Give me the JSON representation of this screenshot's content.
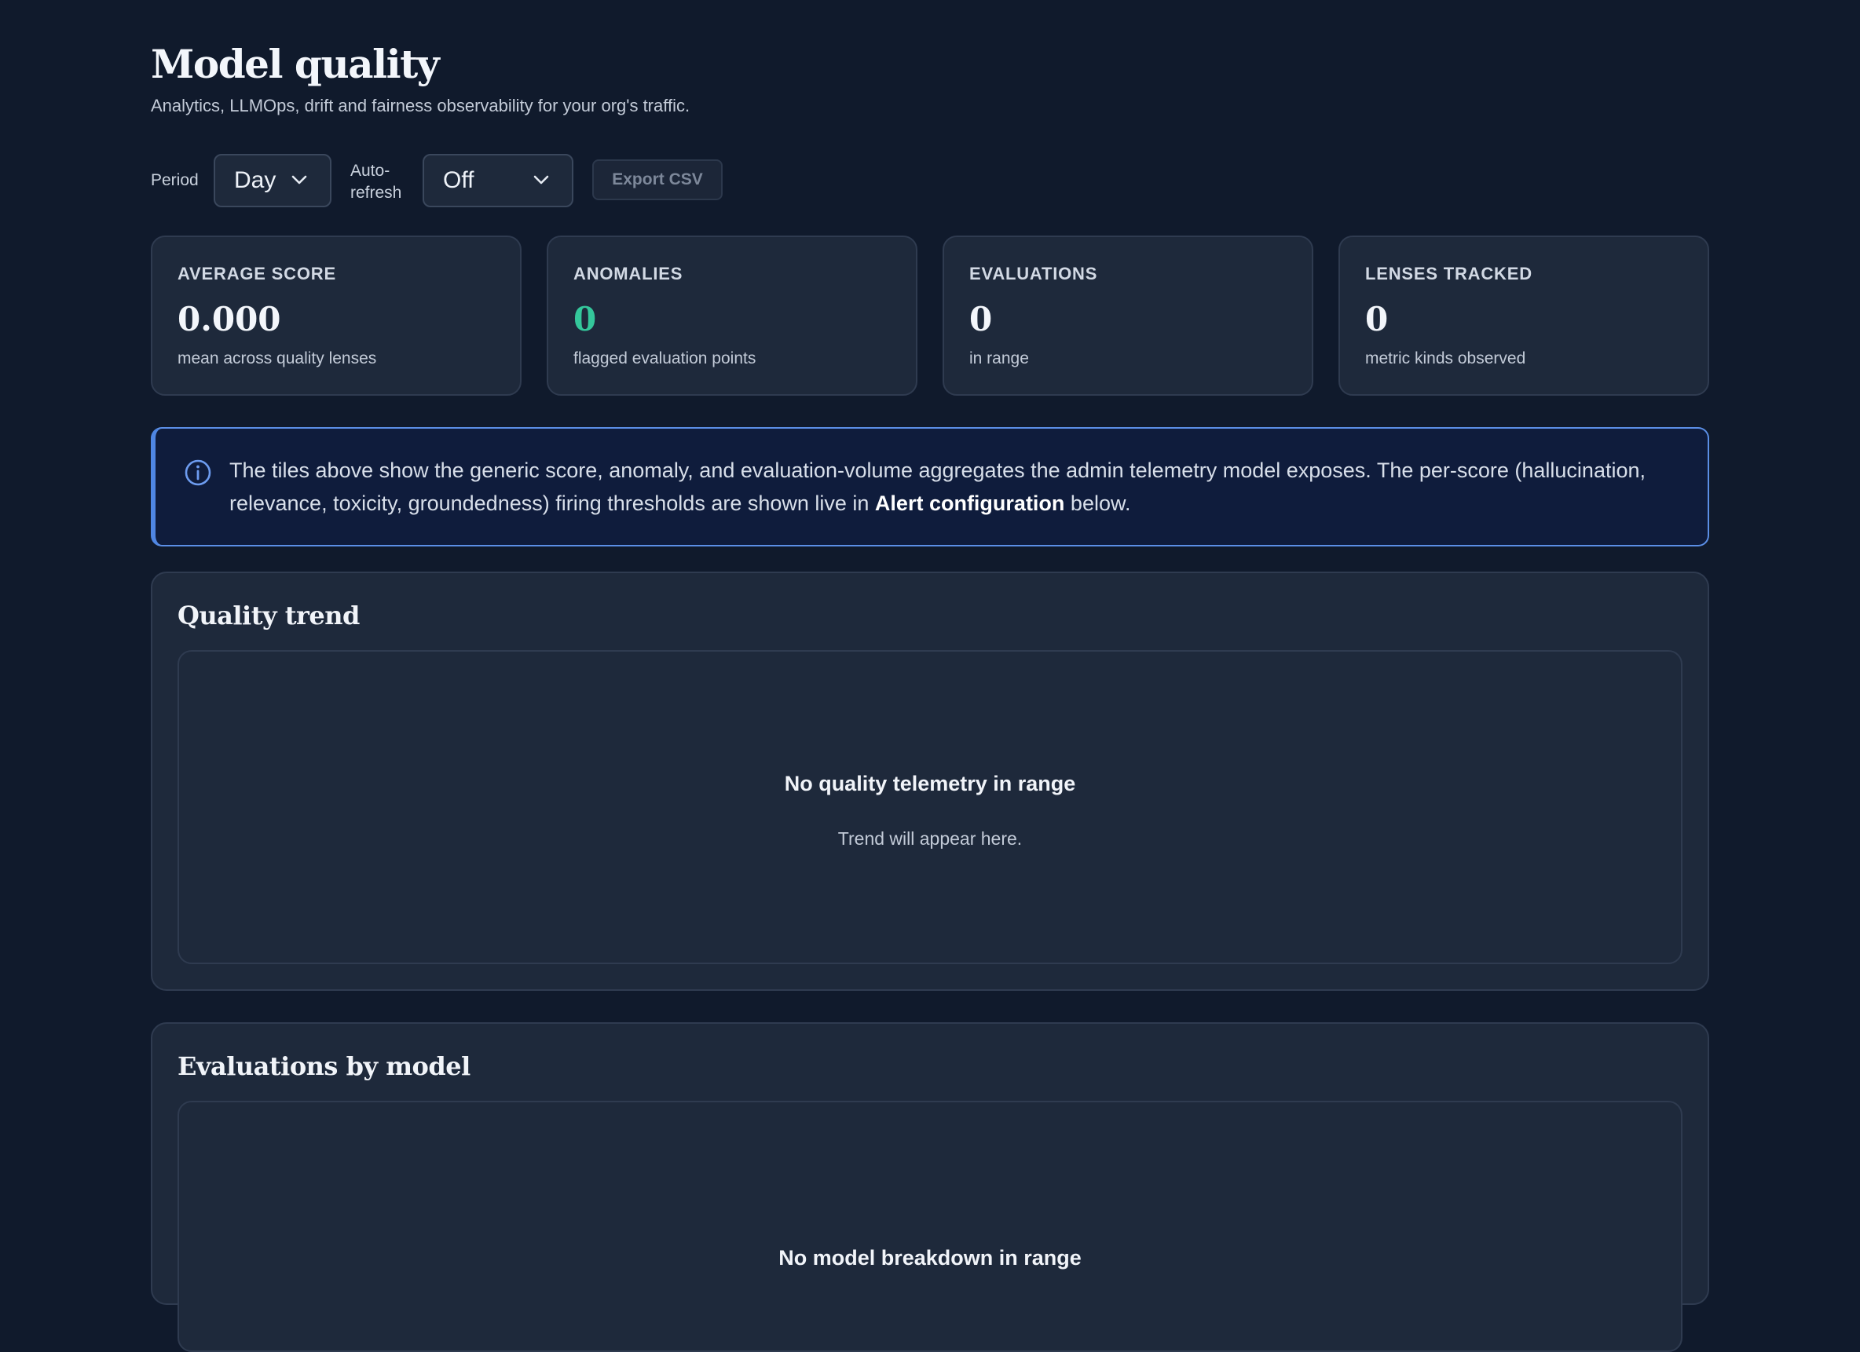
{
  "header": {
    "title": "Model quality",
    "subtitle": "Analytics, LLMOps, drift and fairness observability for your org's traffic."
  },
  "toolbar": {
    "period_label": "Period",
    "period_value": "Day",
    "autorefresh_label_line1": "Auto-",
    "autorefresh_label_line2": "refresh",
    "autorefresh_value": "Off",
    "export_label": "Export CSV"
  },
  "stats": [
    {
      "label": "AVERAGE SCORE",
      "value": "0.000",
      "caption": "mean across quality lenses"
    },
    {
      "label": "ANOMALIES",
      "value": "0",
      "caption": "flagged evaluation points"
    },
    {
      "label": "EVALUATIONS",
      "value": "0",
      "caption": "in range"
    },
    {
      "label": "LENSES TRACKED",
      "value": "0",
      "caption": "metric kinds observed"
    }
  ],
  "info": {
    "text_before": "The tiles above show the generic score, anomaly, and evaluation-volume aggregates the admin telemetry model exposes. The per-score (hallucination, relevance, toxicity, groundedness) firing thresholds are shown live in ",
    "text_bold": "Alert configuration",
    "text_after": " below."
  },
  "quality_trend": {
    "title": "Quality trend",
    "empty_title": "No quality telemetry in range",
    "empty_sub": "Trend will appear here."
  },
  "evaluations_by_model": {
    "title": "Evaluations by model",
    "empty_title": "No model breakdown in range"
  },
  "colors": {
    "background": "#101a2c",
    "card": "#1e293b",
    "accent_green": "#34c79b",
    "info_border": "#5b8fe6"
  }
}
